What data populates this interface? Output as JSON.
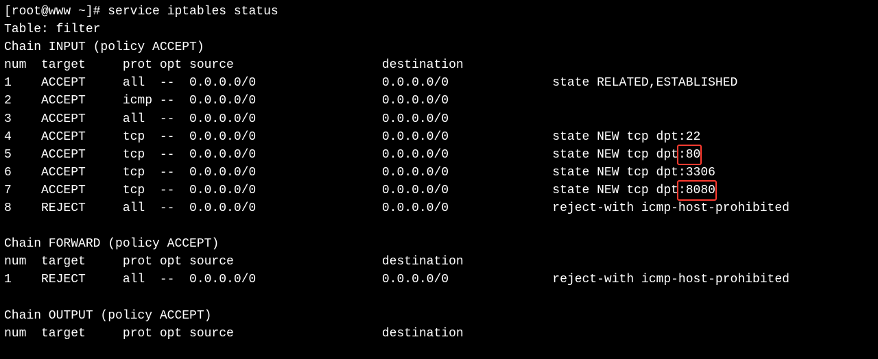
{
  "prompt": "[root@www ~]# ",
  "command": "service iptables status",
  "table_line": "Table: filter",
  "hdr": {
    "num": "num",
    "target": "target",
    "prot": "prot",
    "opt": "opt",
    "source": "source",
    "destination": "destination"
  },
  "chains": {
    "input": {
      "title": "Chain INPUT (policy ACCEPT)",
      "rows": [
        {
          "num": "1",
          "target": "ACCEPT",
          "prot": "all",
          "opt": "--",
          "source": "0.0.0.0/0",
          "dest": "0.0.0.0/0",
          "extra": "state RELATED,ESTABLISHED"
        },
        {
          "num": "2",
          "target": "ACCEPT",
          "prot": "icmp",
          "opt": "--",
          "source": "0.0.0.0/0",
          "dest": "0.0.0.0/0",
          "extra": ""
        },
        {
          "num": "3",
          "target": "ACCEPT",
          "prot": "all",
          "opt": "--",
          "source": "0.0.0.0/0",
          "dest": "0.0.0.0/0",
          "extra": ""
        },
        {
          "num": "4",
          "target": "ACCEPT",
          "prot": "tcp",
          "opt": "--",
          "source": "0.0.0.0/0",
          "dest": "0.0.0.0/0",
          "extra": "state NEW tcp dpt:22"
        },
        {
          "num": "5",
          "target": "ACCEPT",
          "prot": "tcp",
          "opt": "--",
          "source": "0.0.0.0/0",
          "dest": "0.0.0.0/0",
          "extra": "state NEW tcp dpt",
          "hlsuffix": ":80"
        },
        {
          "num": "6",
          "target": "ACCEPT",
          "prot": "tcp",
          "opt": "--",
          "source": "0.0.0.0/0",
          "dest": "0.0.0.0/0",
          "extra": "state NEW tcp dpt:3306"
        },
        {
          "num": "7",
          "target": "ACCEPT",
          "prot": "tcp",
          "opt": "--",
          "source": "0.0.0.0/0",
          "dest": "0.0.0.0/0",
          "extra": "state NEW tcp dpt",
          "hlsuffix": ":8080"
        },
        {
          "num": "8",
          "target": "REJECT",
          "prot": "all",
          "opt": "--",
          "source": "0.0.0.0/0",
          "dest": "0.0.0.0/0",
          "extra": "reject-with icmp-host-prohibited"
        }
      ]
    },
    "forward": {
      "title": "Chain FORWARD (policy ACCEPT)",
      "rows": [
        {
          "num": "1",
          "target": "REJECT",
          "prot": "all",
          "opt": "--",
          "source": "0.0.0.0/0",
          "dest": "0.0.0.0/0",
          "extra": "reject-with icmp-host-prohibited"
        }
      ]
    },
    "output": {
      "title": "Chain OUTPUT (policy ACCEPT)",
      "rows": []
    }
  }
}
